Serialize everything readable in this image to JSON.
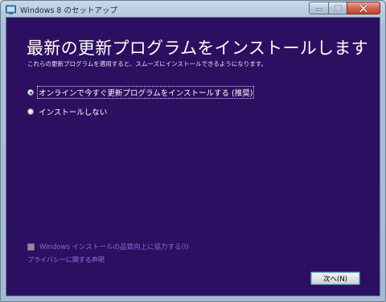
{
  "window": {
    "title": "Windows 8 のセットアップ"
  },
  "main": {
    "heading": "最新の更新プログラムをインストールします",
    "subtitle": "これらの更新プログラムを適用すると、スムーズにインストールできるようになります。",
    "options": [
      {
        "label": "オンラインで今すぐ更新プログラムをインストールする (推奨)",
        "selected": true
      },
      {
        "label": "インストールしない",
        "selected": false
      }
    ],
    "quality_checkbox": {
      "label": "Windows インストールの品質向上に協力する(I)",
      "checked": false
    },
    "privacy_link": "プライバシーに関する声明",
    "next_button": "次へ(N)"
  },
  "colors": {
    "background": "#2d0f61",
    "link": "#9a74e6"
  }
}
